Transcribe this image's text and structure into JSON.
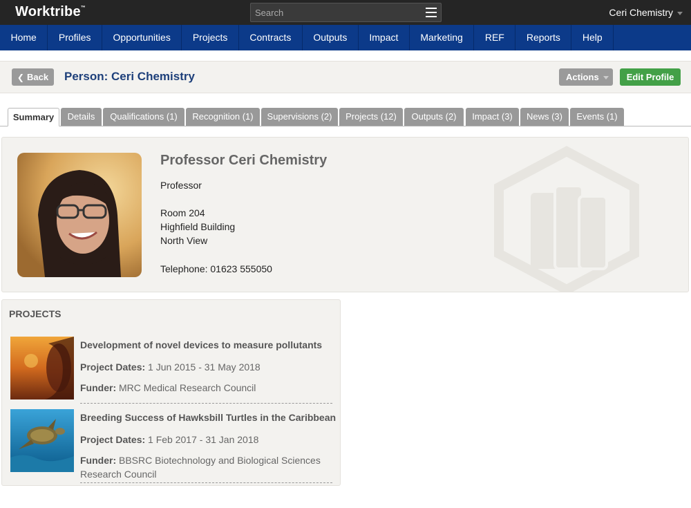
{
  "app": {
    "logo": "Worktribe",
    "logo_tm": "™",
    "search_placeholder": "Search",
    "user_name": "Ceri Chemistry"
  },
  "nav": {
    "items": [
      "Home",
      "Profiles",
      "Opportunities",
      "Projects",
      "Contracts",
      "Outputs",
      "Impact",
      "Marketing",
      "REF",
      "Reports",
      "Help"
    ]
  },
  "titlebar": {
    "back_label": "Back",
    "title": "Person: Ceri Chemistry",
    "actions_label": "Actions",
    "edit_label": "Edit Profile"
  },
  "tabs": [
    {
      "label": "Summary",
      "active": true
    },
    {
      "label": "Details"
    },
    {
      "label": "Qualifications (1)"
    },
    {
      "label": "Recognition (1)"
    },
    {
      "label": "Supervisions (2)"
    },
    {
      "label": "Projects (12)"
    },
    {
      "label": "Outputs (2)"
    },
    {
      "label": "Impact (3)"
    },
    {
      "label": "News (3)"
    },
    {
      "label": "Events (1)"
    }
  ],
  "profile": {
    "name": "Professor Ceri Chemistry",
    "position": "Professor",
    "address_line1": "Room 204",
    "address_line2": "Highfield Building",
    "address_line3": "North View",
    "telephone": "Telephone: 01623 555050"
  },
  "projects": {
    "heading": "PROJECTS",
    "items": [
      {
        "title": "Development of novel devices to measure pollutants",
        "dates_label": "Project Dates:",
        "dates": "1 Jun 2015 - 31 May 2018",
        "funder_label": "Funder:",
        "funder": "MRC Medical Research Council"
      },
      {
        "title": "Breeding Success of Hawksbill Turtles in the Caribbean",
        "dates_label": "Project Dates:",
        "dates": "1 Feb 2017 - 31 Jan 2018",
        "funder_label": "Funder:",
        "funder": "BBSRC Biotechnology and Biological Sciences Research Council"
      }
    ]
  },
  "colors": {
    "topbar": "#252525",
    "nav": "#0c3a89",
    "edit_button": "#43a047",
    "title_text": "#1d3f7a"
  }
}
